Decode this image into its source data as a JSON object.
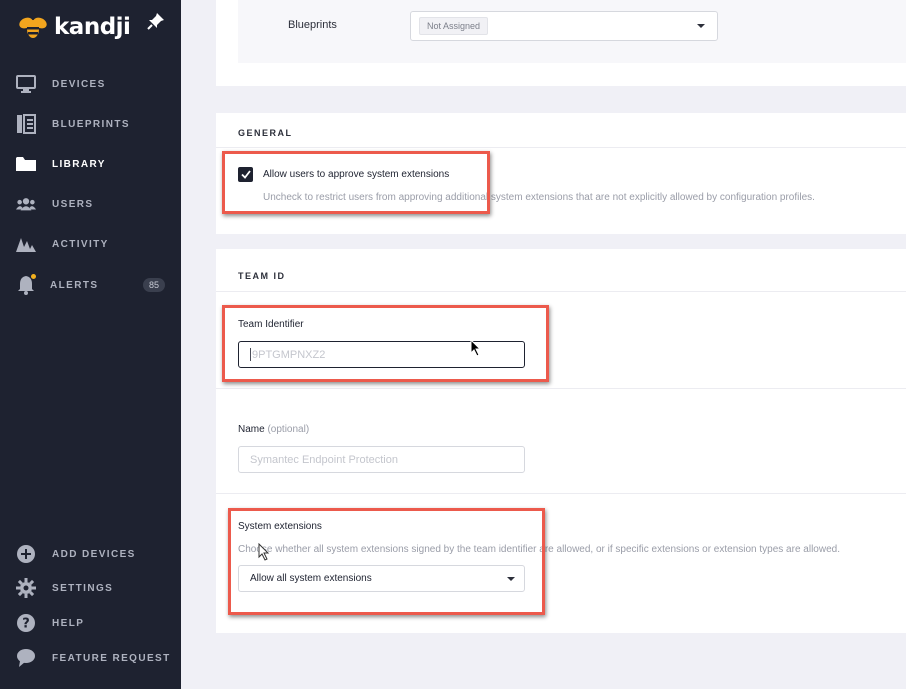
{
  "brand": {
    "name": "kandji"
  },
  "sidebar": {
    "items": [
      {
        "label": "DEVICES",
        "icon": "monitor-icon"
      },
      {
        "label": "BLUEPRINTS",
        "icon": "blueprints-icon"
      },
      {
        "label": "LIBRARY",
        "icon": "folder-icon",
        "active": true
      },
      {
        "label": "USERS",
        "icon": "users-icon"
      },
      {
        "label": "ACTIVITY",
        "icon": "activity-icon"
      },
      {
        "label": "ALERTS",
        "icon": "bell-icon",
        "badge": "85"
      }
    ],
    "bottom_items": [
      {
        "label": "ADD DEVICES",
        "icon": "plus-circle-icon"
      },
      {
        "label": "SETTINGS",
        "icon": "gear-icon"
      },
      {
        "label": "HELP",
        "icon": "help-icon"
      },
      {
        "label": "FEATURE REQUEST",
        "icon": "chat-icon"
      }
    ]
  },
  "blueprints": {
    "label": "Blueprints",
    "value": "Not Assigned"
  },
  "general": {
    "title": "GENERAL",
    "checkbox_label": "Allow users to approve system extensions",
    "checkbox_checked": true,
    "help": "Uncheck to restrict users from approving additional system extensions that are not explicitly allowed by configuration profiles."
  },
  "team": {
    "title": "TEAM ID",
    "team_identifier_label": "Team Identifier",
    "team_identifier_placeholder": "9PTGMPNXZ2",
    "name_label": "Name",
    "name_optional": "(optional)",
    "name_placeholder": "Symantec Endpoint Protection",
    "system_extensions_label": "System extensions",
    "system_extensions_help": "Choose whether all system extensions signed by the team identifier are allowed, or if specific extensions or extension types are allowed.",
    "system_extensions_value": "Allow all system extensions"
  },
  "colors": {
    "sidebar_bg": "#1e2230",
    "highlight": "#ec5a4c",
    "accent": "#f2b01e"
  }
}
